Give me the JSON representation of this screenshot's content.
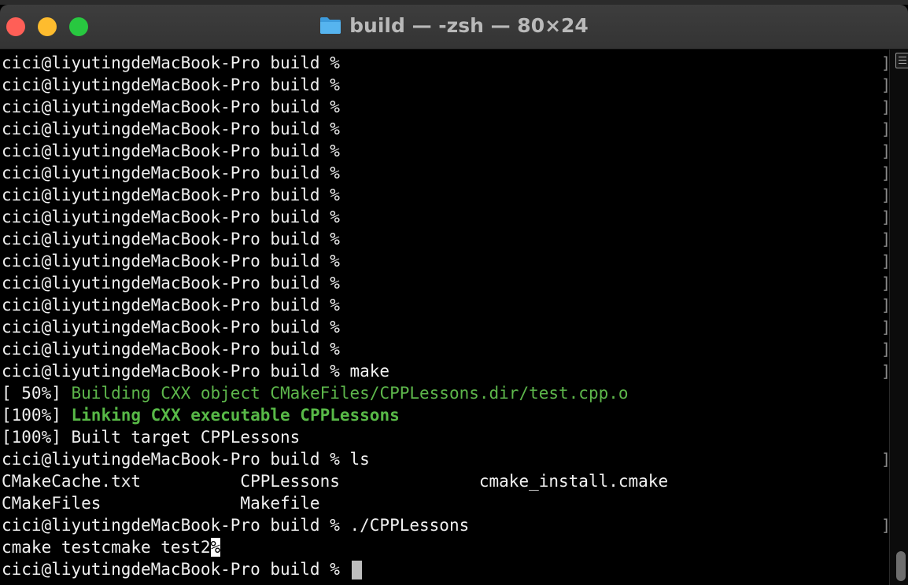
{
  "window": {
    "title": "build — -zsh — 80×24"
  },
  "terminal": {
    "lines": [
      {
        "text": "cici@liyutingdeMacBook-Pro build %"
      },
      {
        "text": "cici@liyutingdeMacBook-Pro build %"
      },
      {
        "text": "cici@liyutingdeMacBook-Pro build %"
      },
      {
        "text": "cici@liyutingdeMacBook-Pro build %"
      },
      {
        "text": "cici@liyutingdeMacBook-Pro build %"
      },
      {
        "text": "cici@liyutingdeMacBook-Pro build %"
      },
      {
        "text": "cici@liyutingdeMacBook-Pro build %"
      },
      {
        "text": "cici@liyutingdeMacBook-Pro build %"
      },
      {
        "text": "cici@liyutingdeMacBook-Pro build %"
      },
      {
        "text": "cici@liyutingdeMacBook-Pro build %"
      },
      {
        "text": "cici@liyutingdeMacBook-Pro build %"
      },
      {
        "text": "cici@liyutingdeMacBook-Pro build %"
      },
      {
        "text": "cici@liyutingdeMacBook-Pro build %"
      },
      {
        "text": "cici@liyutingdeMacBook-Pro build %"
      },
      {
        "text": "cici@liyutingdeMacBook-Pro build % make"
      },
      {
        "text": "[ 50%] ",
        "colored": "Building CXX object CMakeFiles/CPPLessons.dir/test.cpp.o"
      },
      {
        "text": "[100%] ",
        "colored": "Linking CXX executable CPPLessons"
      },
      {
        "text": "[100%] Built target CPPLessons"
      },
      {
        "text": "cici@liyutingdeMacBook-Pro build % ls"
      },
      {
        "text": "CMakeCache.txt          CPPLessons              cmake_install.cmake"
      },
      {
        "text": "CMakeFiles              Makefile"
      },
      {
        "text": "cici@liyutingdeMacBook-Pro build % ./CPPLessons"
      },
      {
        "text": "cmake testcmake test2",
        "marker": "%"
      },
      {
        "text": "cici@liyutingdeMacBook-Pro build % "
      }
    ],
    "mark_glyph": "]"
  },
  "colors": {
    "green": "#5db64b",
    "background": "#000000",
    "foreground": "#f0f0f0"
  },
  "icons": {
    "title": "folder-icon",
    "scrollbar": "marks-list-icon"
  }
}
